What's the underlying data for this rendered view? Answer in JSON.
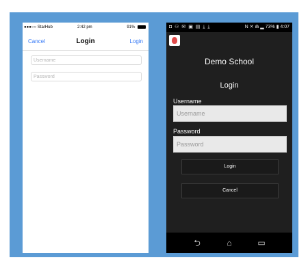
{
  "ios": {
    "status": {
      "carrier": "●●●○○ StarHub",
      "wifi_icon": "wifi-icon",
      "time": "2:42 pm",
      "battery_text": "91%"
    },
    "nav": {
      "cancel": "Cancel",
      "title": "Login",
      "login": "Login"
    },
    "fields": {
      "username_placeholder": "Username",
      "password_placeholder": "Password"
    }
  },
  "android": {
    "status": {
      "left_icons": "◘ ⚇ ✉ ▣ ▤ ⤓ ⤓",
      "right_text": "N ✕ ⋒ ▂ 73% ▮ 4:07"
    },
    "app_title": "Demo School",
    "subtitle": "Login",
    "username_label": "Username",
    "username_placeholder": "Username",
    "password_label": "Password",
    "password_placeholder": "Password",
    "login_button": "Login",
    "cancel_button": "Cancel",
    "nav": {
      "back": "⮌",
      "home": "⌂",
      "recent": "▭"
    }
  }
}
